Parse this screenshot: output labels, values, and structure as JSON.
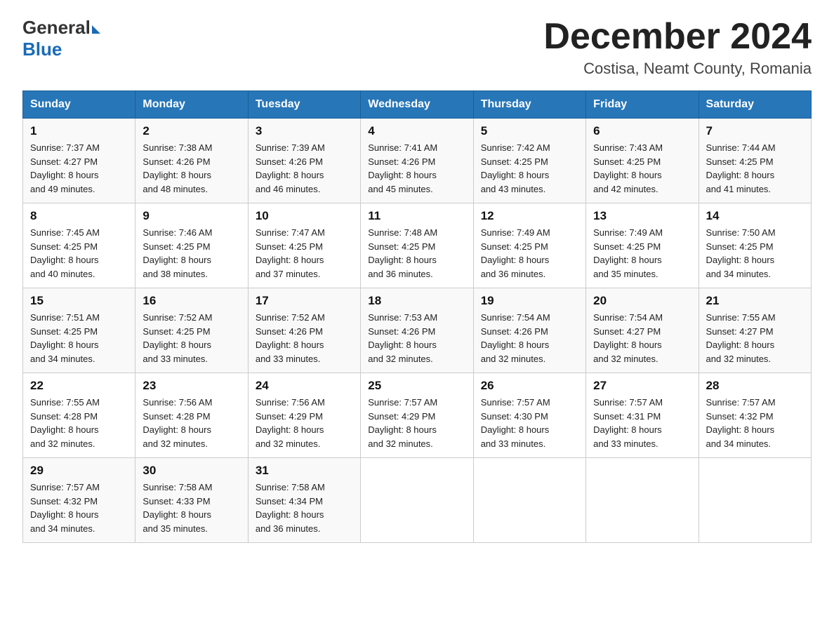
{
  "logo": {
    "general": "General",
    "blue": "Blue"
  },
  "title": {
    "month_year": "December 2024",
    "location": "Costisa, Neamt County, Romania"
  },
  "headers": [
    "Sunday",
    "Monday",
    "Tuesday",
    "Wednesday",
    "Thursday",
    "Friday",
    "Saturday"
  ],
  "weeks": [
    [
      {
        "day": "1",
        "sunrise": "7:37 AM",
        "sunset": "4:27 PM",
        "daylight": "8 hours and 49 minutes."
      },
      {
        "day": "2",
        "sunrise": "7:38 AM",
        "sunset": "4:26 PM",
        "daylight": "8 hours and 48 minutes."
      },
      {
        "day": "3",
        "sunrise": "7:39 AM",
        "sunset": "4:26 PM",
        "daylight": "8 hours and 46 minutes."
      },
      {
        "day": "4",
        "sunrise": "7:41 AM",
        "sunset": "4:26 PM",
        "daylight": "8 hours and 45 minutes."
      },
      {
        "day": "5",
        "sunrise": "7:42 AM",
        "sunset": "4:25 PM",
        "daylight": "8 hours and 43 minutes."
      },
      {
        "day": "6",
        "sunrise": "7:43 AM",
        "sunset": "4:25 PM",
        "daylight": "8 hours and 42 minutes."
      },
      {
        "day": "7",
        "sunrise": "7:44 AM",
        "sunset": "4:25 PM",
        "daylight": "8 hours and 41 minutes."
      }
    ],
    [
      {
        "day": "8",
        "sunrise": "7:45 AM",
        "sunset": "4:25 PM",
        "daylight": "8 hours and 40 minutes."
      },
      {
        "day": "9",
        "sunrise": "7:46 AM",
        "sunset": "4:25 PM",
        "daylight": "8 hours and 38 minutes."
      },
      {
        "day": "10",
        "sunrise": "7:47 AM",
        "sunset": "4:25 PM",
        "daylight": "8 hours and 37 minutes."
      },
      {
        "day": "11",
        "sunrise": "7:48 AM",
        "sunset": "4:25 PM",
        "daylight": "8 hours and 36 minutes."
      },
      {
        "day": "12",
        "sunrise": "7:49 AM",
        "sunset": "4:25 PM",
        "daylight": "8 hours and 36 minutes."
      },
      {
        "day": "13",
        "sunrise": "7:49 AM",
        "sunset": "4:25 PM",
        "daylight": "8 hours and 35 minutes."
      },
      {
        "day": "14",
        "sunrise": "7:50 AM",
        "sunset": "4:25 PM",
        "daylight": "8 hours and 34 minutes."
      }
    ],
    [
      {
        "day": "15",
        "sunrise": "7:51 AM",
        "sunset": "4:25 PM",
        "daylight": "8 hours and 34 minutes."
      },
      {
        "day": "16",
        "sunrise": "7:52 AM",
        "sunset": "4:25 PM",
        "daylight": "8 hours and 33 minutes."
      },
      {
        "day": "17",
        "sunrise": "7:52 AM",
        "sunset": "4:26 PM",
        "daylight": "8 hours and 33 minutes."
      },
      {
        "day": "18",
        "sunrise": "7:53 AM",
        "sunset": "4:26 PM",
        "daylight": "8 hours and 32 minutes."
      },
      {
        "day": "19",
        "sunrise": "7:54 AM",
        "sunset": "4:26 PM",
        "daylight": "8 hours and 32 minutes."
      },
      {
        "day": "20",
        "sunrise": "7:54 AM",
        "sunset": "4:27 PM",
        "daylight": "8 hours and 32 minutes."
      },
      {
        "day": "21",
        "sunrise": "7:55 AM",
        "sunset": "4:27 PM",
        "daylight": "8 hours and 32 minutes."
      }
    ],
    [
      {
        "day": "22",
        "sunrise": "7:55 AM",
        "sunset": "4:28 PM",
        "daylight": "8 hours and 32 minutes."
      },
      {
        "day": "23",
        "sunrise": "7:56 AM",
        "sunset": "4:28 PM",
        "daylight": "8 hours and 32 minutes."
      },
      {
        "day": "24",
        "sunrise": "7:56 AM",
        "sunset": "4:29 PM",
        "daylight": "8 hours and 32 minutes."
      },
      {
        "day": "25",
        "sunrise": "7:57 AM",
        "sunset": "4:29 PM",
        "daylight": "8 hours and 32 minutes."
      },
      {
        "day": "26",
        "sunrise": "7:57 AM",
        "sunset": "4:30 PM",
        "daylight": "8 hours and 33 minutes."
      },
      {
        "day": "27",
        "sunrise": "7:57 AM",
        "sunset": "4:31 PM",
        "daylight": "8 hours and 33 minutes."
      },
      {
        "day": "28",
        "sunrise": "7:57 AM",
        "sunset": "4:32 PM",
        "daylight": "8 hours and 34 minutes."
      }
    ],
    [
      {
        "day": "29",
        "sunrise": "7:57 AM",
        "sunset": "4:32 PM",
        "daylight": "8 hours and 34 minutes."
      },
      {
        "day": "30",
        "sunrise": "7:58 AM",
        "sunset": "4:33 PM",
        "daylight": "8 hours and 35 minutes."
      },
      {
        "day": "31",
        "sunrise": "7:58 AM",
        "sunset": "4:34 PM",
        "daylight": "8 hours and 36 minutes."
      },
      null,
      null,
      null,
      null
    ]
  ],
  "labels": {
    "sunrise_prefix": "Sunrise: ",
    "sunset_prefix": "Sunset: ",
    "daylight_prefix": "Daylight: "
  }
}
